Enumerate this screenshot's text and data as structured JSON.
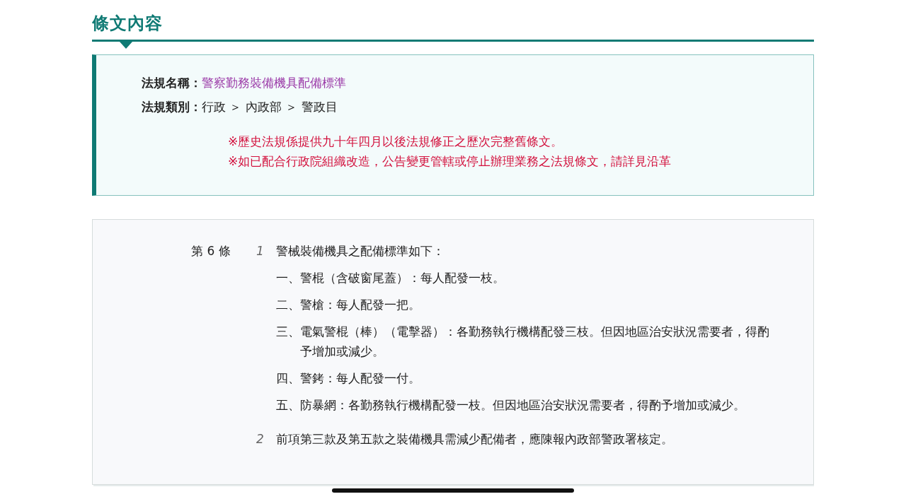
{
  "section_title": "條文內容",
  "regulation_info": {
    "fields": [
      {
        "label": "法規名稱：",
        "value": "警察勤務裝備機具配備標準",
        "kind": "link"
      },
      {
        "label": "法規類別：",
        "value": "行政 ＞ 內政部 ＞ 警政目",
        "kind": "text"
      }
    ],
    "notes": [
      "※歷史法規係提供九十年四月以後法規修正之歷次完整舊條文。",
      "※如已配合行政院組織改造，公告變更管轄或停止辦理業務之法規條文，請詳見沿革"
    ]
  },
  "article": {
    "number": "第 6 條",
    "paragraphs": [
      {
        "number": "1",
        "text": "警械裝備機具之配備標準如下：",
        "items": [
          "一、警棍（含破窗尾蓋）：每人配發一枝。",
          "二、警槍：每人配發一把。",
          "三、電氣警棍（棒）（電擊器）：各勤務執行機構配發三枝。但因地區治安狀況需要者，得酌予增加或減少。",
          "四、警銬：每人配發一付。",
          "五、防暴網：各勤務執行機構配發一枝。但因地區治安狀況需要者，得酌予增加或減少。"
        ]
      },
      {
        "number": "2",
        "text": "前項第三款及第五款之裝備機具需減少配備者，應陳報內政部警政署核定。"
      }
    ]
  }
}
